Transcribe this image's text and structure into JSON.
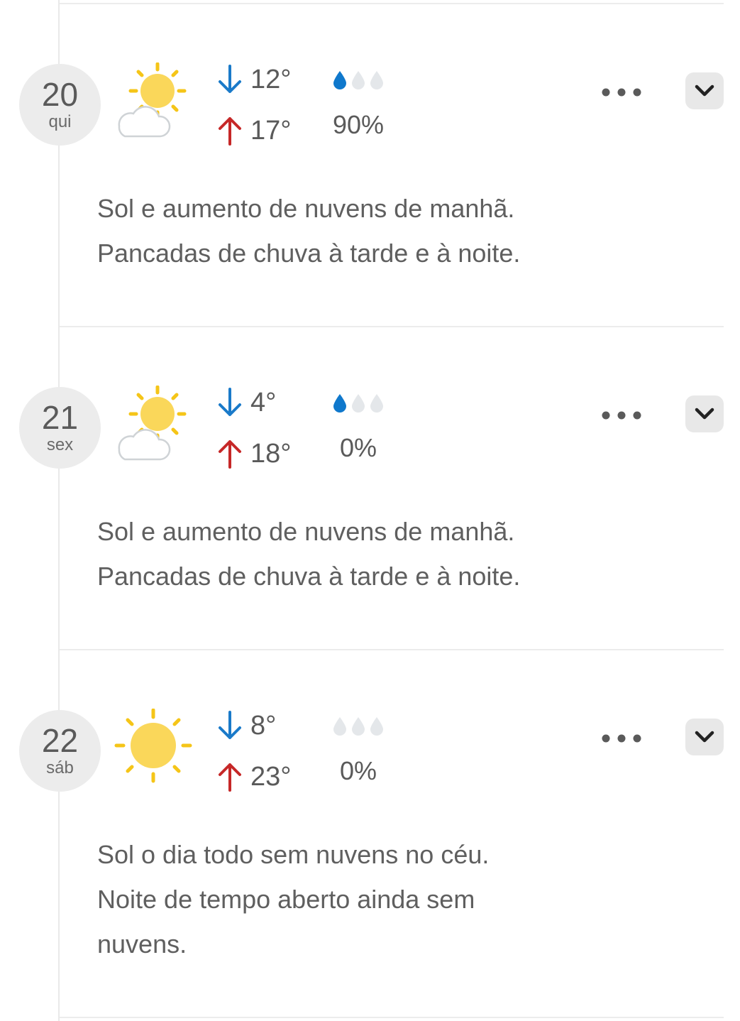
{
  "days": [
    {
      "day_num": "20",
      "weekday": "qui",
      "icon": "sun-partly-cloudy-icon",
      "min_temp": "12°",
      "max_temp": "17°",
      "rain_drops_filled": 1,
      "precip": "90%",
      "desc_line1": "Sol e aumento de nuvens de manhã.",
      "desc_line2": "Pancadas de chuva à tarde e à noite.",
      "desc_line3": ""
    },
    {
      "day_num": "21",
      "weekday": "sex",
      "icon": "sun-partly-cloudy-icon",
      "min_temp": "4°",
      "max_temp": "18°",
      "rain_drops_filled": 1,
      "precip": "0%",
      "desc_line1": "Sol e aumento de nuvens de manhã.",
      "desc_line2": "Pancadas de chuva à tarde e à noite.",
      "desc_line3": ""
    },
    {
      "day_num": "22",
      "weekday": "sáb",
      "icon": "sun-icon",
      "min_temp": "8°",
      "max_temp": "23°",
      "rain_drops_filled": 0,
      "precip": "0%",
      "desc_line1": "Sol o dia todo sem nuvens no céu.",
      "desc_line2": "Noite de tempo aberto ainda sem",
      "desc_line3": "nuvens."
    }
  ],
  "icons": {
    "min_arrow": "arrow-down-icon",
    "max_arrow": "arrow-up-icon",
    "more": "more-options-icon",
    "expand": "chevron-down-icon"
  },
  "colors": {
    "min_arrow": "#1a7ac9",
    "max_arrow": "#c62828",
    "drop_filled": "#0f78cc",
    "drop_empty": "#e4e7ea",
    "sun": "#fad75a",
    "sun_ray": "#f5c518"
  }
}
